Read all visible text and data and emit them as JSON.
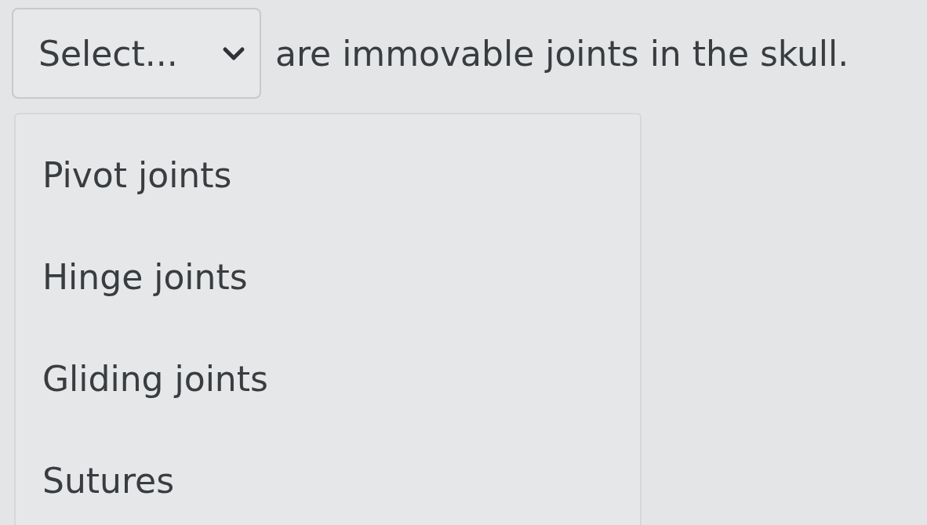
{
  "question": {
    "select": {
      "placeholder": "Select...",
      "expanded": true
    },
    "sentence": "are immovable joints in the skull."
  },
  "options": [
    {
      "label": "Pivot joints",
      "selected": false
    },
    {
      "label": "Hinge joints",
      "selected": false
    },
    {
      "label": "Gliding joints",
      "selected": false
    },
    {
      "label": "Sutures",
      "selected": false
    }
  ]
}
